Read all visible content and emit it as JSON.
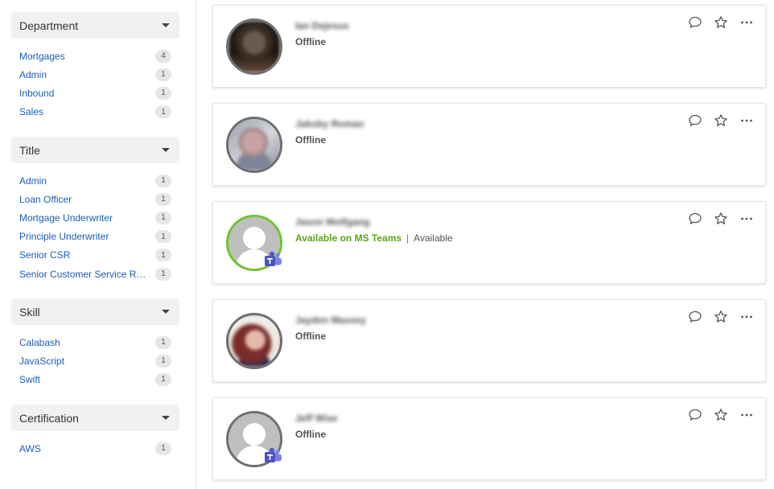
{
  "facets": [
    {
      "title": "Department",
      "items": [
        {
          "label": "Mortgages",
          "count": "4"
        },
        {
          "label": "Admin",
          "count": "1"
        },
        {
          "label": "Inbound",
          "count": "1"
        },
        {
          "label": "Sales",
          "count": "1"
        }
      ]
    },
    {
      "title": "Title",
      "items": [
        {
          "label": "Admin",
          "count": "1"
        },
        {
          "label": "Loan Officer",
          "count": "1"
        },
        {
          "label": "Mortgage Underwriter",
          "count": "1"
        },
        {
          "label": "Principle Underwriter",
          "count": "1"
        },
        {
          "label": "Senior CSR",
          "count": "1"
        },
        {
          "label": "Senior Customer Service Re...",
          "count": "1"
        }
      ]
    },
    {
      "title": "Skill",
      "items": [
        {
          "label": "Calabash",
          "count": "1"
        },
        {
          "label": "JavaScript",
          "count": "1"
        },
        {
          "label": "Swift",
          "count": "1"
        }
      ]
    },
    {
      "title": "Certification",
      "items": [
        {
          "label": "AWS",
          "count": "1"
        }
      ]
    }
  ],
  "people": [
    {
      "name": "Ian Dejesus",
      "status": "Offline"
    },
    {
      "name": "Jakoby Roman",
      "status": "Offline"
    },
    {
      "name": "Jason Wolfgang",
      "status": "Available on MS Teams",
      "status_separator": "|",
      "presence": "Available"
    },
    {
      "name": "Jayden Massey",
      "status": "Offline"
    },
    {
      "name": "Jeff Wise",
      "status": "Offline"
    }
  ],
  "colors": {
    "link": "#1a5db8",
    "available_ring": "#72c52c",
    "available_text": "#5aa51a",
    "offline_ring": "#6f6f6f",
    "teams": "#5059c9"
  }
}
